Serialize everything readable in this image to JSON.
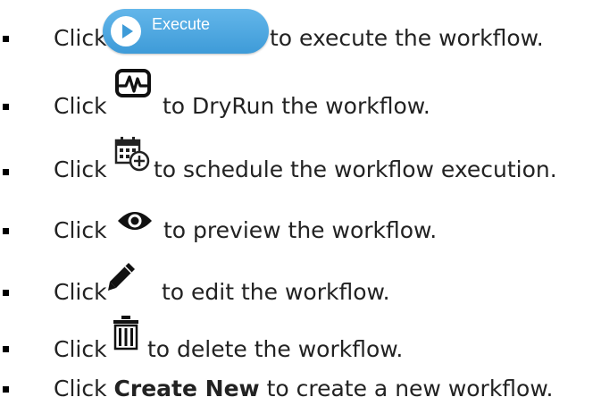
{
  "items": [
    {
      "click": "Click",
      "button_label": "Execute",
      "rest": "to execute the workflow.",
      "icon": "play-circle-icon"
    },
    {
      "click": "Click",
      "rest": "to DryRun the workflow.",
      "icon": "pulse-monitor-icon"
    },
    {
      "click": "Click",
      "rest": "to schedule the workflow execution.",
      "icon": "calendar-add-icon"
    },
    {
      "click": "Click",
      "rest": "to preview the workflow.",
      "icon": "eye-icon"
    },
    {
      "click": "Click",
      "rest": "to edit the workflow.",
      "icon": "pencil-icon"
    },
    {
      "click": "Click",
      "rest": "to delete the workflow.",
      "icon": "trash-icon"
    },
    {
      "click": "Click",
      "bold": "Create New",
      "rest": "to create a new workflow."
    }
  ]
}
